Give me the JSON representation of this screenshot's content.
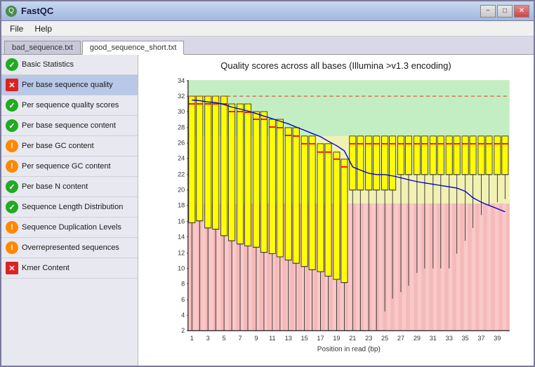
{
  "window": {
    "title": "FastQC",
    "controls": {
      "minimize": "−",
      "maximize": "□",
      "close": "✕"
    }
  },
  "menu": {
    "items": [
      "File",
      "Help"
    ]
  },
  "tabs": [
    {
      "label": "bad_sequence.txt",
      "active": false
    },
    {
      "label": "good_sequence_short.txt",
      "active": true
    }
  ],
  "sidebar": {
    "items": [
      {
        "label": "Basic Statistics",
        "status": "ok",
        "selected": false
      },
      {
        "label": "Per base sequence quality",
        "status": "fail",
        "selected": true
      },
      {
        "label": "Per sequence quality scores",
        "status": "ok",
        "selected": false
      },
      {
        "label": "Per base sequence content",
        "status": "ok",
        "selected": false
      },
      {
        "label": "Per base GC content",
        "status": "warn",
        "selected": false
      },
      {
        "label": "Per sequence GC content",
        "status": "warn",
        "selected": false
      },
      {
        "label": "Per base N content",
        "status": "ok",
        "selected": false
      },
      {
        "label": "Sequence Length Distribution",
        "status": "ok",
        "selected": false
      },
      {
        "label": "Sequence Duplication Levels",
        "status": "warn",
        "selected": false
      },
      {
        "label": "Overrepresented sequences",
        "status": "warn",
        "selected": false
      },
      {
        "label": "Kmer Content",
        "status": "fail",
        "selected": false
      }
    ]
  },
  "chart": {
    "title": "Quality scores across all bases (Illumina >v1.3 encoding)",
    "x_axis_label": "Position in read (bp)",
    "y_axis_label": "",
    "x_ticks": [
      "1",
      "3",
      "5",
      "7",
      "9",
      "11",
      "13",
      "15",
      "17",
      "19",
      "21",
      "23",
      "25",
      "27",
      "29",
      "31",
      "33",
      "35",
      "37",
      "39"
    ],
    "y_ticks": [
      "2",
      "4",
      "6",
      "8",
      "10",
      "12",
      "14",
      "16",
      "18",
      "20",
      "22",
      "24",
      "26",
      "28",
      "30",
      "32",
      "34"
    ],
    "colors": {
      "green_zone": "#88dd88",
      "yellow_zone": "#dddd44",
      "red_zone": "#ee8888",
      "box_fill": "#ffff00",
      "box_stroke": "#333333",
      "median_line": "#ff0000",
      "mean_line": "#0000ff",
      "whisker": "#333333"
    }
  }
}
